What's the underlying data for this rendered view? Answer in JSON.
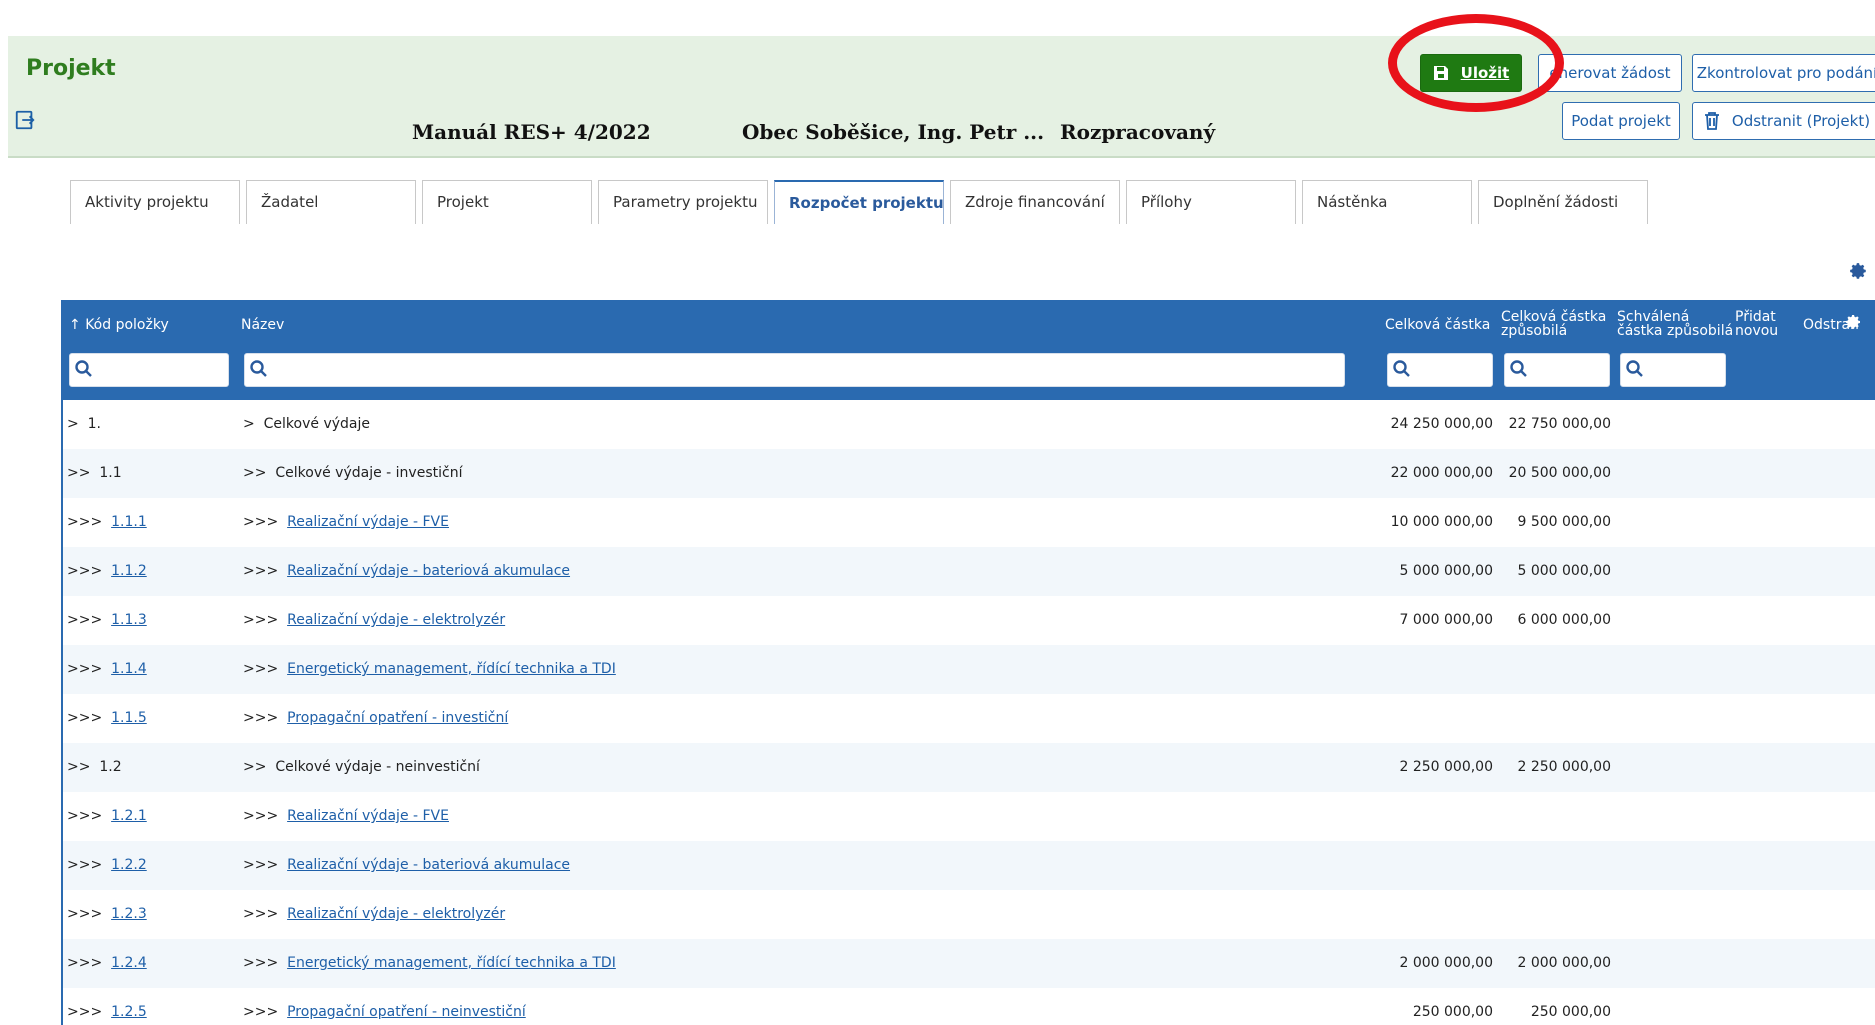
{
  "header": {
    "title": "Projekt",
    "call_name": "Manuál RES+ 4/2022",
    "applicant": "Obec Soběšice, Ing. Petr ...",
    "status": "Rozpracovaný",
    "exit_icon": "exit-icon"
  },
  "actions": {
    "save": "Uložit",
    "generate": "enerovat žádost",
    "check": "Zkontrolovat pro podání",
    "submit": "Podat projekt",
    "delete": "Odstranit (Projekt)"
  },
  "tabs": [
    {
      "label": "Aktivity projektu"
    },
    {
      "label": "Žadatel"
    },
    {
      "label": "Projekt"
    },
    {
      "label": "Parametry projektu"
    },
    {
      "label": "Rozpočet projektu"
    },
    {
      "label": "Zdroje financování"
    },
    {
      "label": "Přílohy"
    },
    {
      "label": "Nástěnka"
    },
    {
      "label": "Doplnění žádosti"
    }
  ],
  "active_tab": "Rozpočet projektu",
  "table": {
    "headers": {
      "code": "Kód položky",
      "name": "Název",
      "total": "Celková částka",
      "total_eligible": "Celková částka způsobilá",
      "approved_eligible": "Schválená částka způsobilá",
      "add_new": "Přidat novou",
      "remove": "Odstran"
    },
    "rows": [
      {
        "prefix": ">",
        "code": "1.",
        "name_prefix": ">",
        "name": "Celkové výdaje",
        "link": false,
        "total": "24 250 000,00",
        "eligible": "22 750 000,00"
      },
      {
        "prefix": ">>",
        "code": "1.1",
        "name_prefix": ">>",
        "name": "Celkové výdaje - investiční",
        "link": false,
        "total": "22 000 000,00",
        "eligible": "20 500 000,00"
      },
      {
        "prefix": ">>>",
        "code": "1.1.1",
        "name_prefix": ">>>",
        "name": "Realizační výdaje - FVE",
        "link": true,
        "total": "10 000 000,00",
        "eligible": "9 500 000,00"
      },
      {
        "prefix": ">>>",
        "code": "1.1.2",
        "name_prefix": ">>>",
        "name": "Realizační výdaje - bateriová akumulace",
        "link": true,
        "total": "5 000 000,00",
        "eligible": "5 000 000,00"
      },
      {
        "prefix": ">>>",
        "code": "1.1.3",
        "name_prefix": ">>>",
        "name": "Realizační výdaje - elektrolyzér",
        "link": true,
        "total": "7 000 000,00",
        "eligible": "6 000 000,00"
      },
      {
        "prefix": ">>>",
        "code": "1.1.4",
        "name_prefix": ">>>",
        "name": "Energetický management, řídící technika a TDI",
        "link": true,
        "total": "",
        "eligible": ""
      },
      {
        "prefix": ">>>",
        "code": "1.1.5",
        "name_prefix": ">>>",
        "name": "Propagační opatření - investiční",
        "link": true,
        "total": "",
        "eligible": ""
      },
      {
        "prefix": ">>",
        "code": "1.2",
        "name_prefix": ">>",
        "name": "Celkové výdaje - neinvestiční",
        "link": false,
        "total": "2 250 000,00",
        "eligible": "2 250 000,00"
      },
      {
        "prefix": ">>>",
        "code": "1.2.1",
        "name_prefix": ">>>",
        "name": "Realizační výdaje - FVE",
        "link": true,
        "total": "",
        "eligible": ""
      },
      {
        "prefix": ">>>",
        "code": "1.2.2",
        "name_prefix": ">>>",
        "name": "Realizační výdaje - bateriová akumulace",
        "link": true,
        "total": "",
        "eligible": ""
      },
      {
        "prefix": ">>>",
        "code": "1.2.3",
        "name_prefix": ">>>",
        "name": "Realizační výdaje - elektrolyzér",
        "link": true,
        "total": "",
        "eligible": ""
      },
      {
        "prefix": ">>>",
        "code": "1.2.4",
        "name_prefix": ">>>",
        "name": "Energetický management, řídící technika a TDI",
        "link": true,
        "total": "2 000 000,00",
        "eligible": "2 000 000,00"
      },
      {
        "prefix": ">>>",
        "code": "1.2.5",
        "name_prefix": ">>>",
        "name": "Propagační opatření - neinvestiční",
        "link": true,
        "total": "250 000,00",
        "eligible": "250 000,00"
      }
    ]
  },
  "colors": {
    "header_bg": "#e5f1e3",
    "title_green": "#2f7d1f",
    "save_green": "#1f7a12",
    "table_blue": "#2a6ab0",
    "highlight_red": "#e8121a"
  }
}
